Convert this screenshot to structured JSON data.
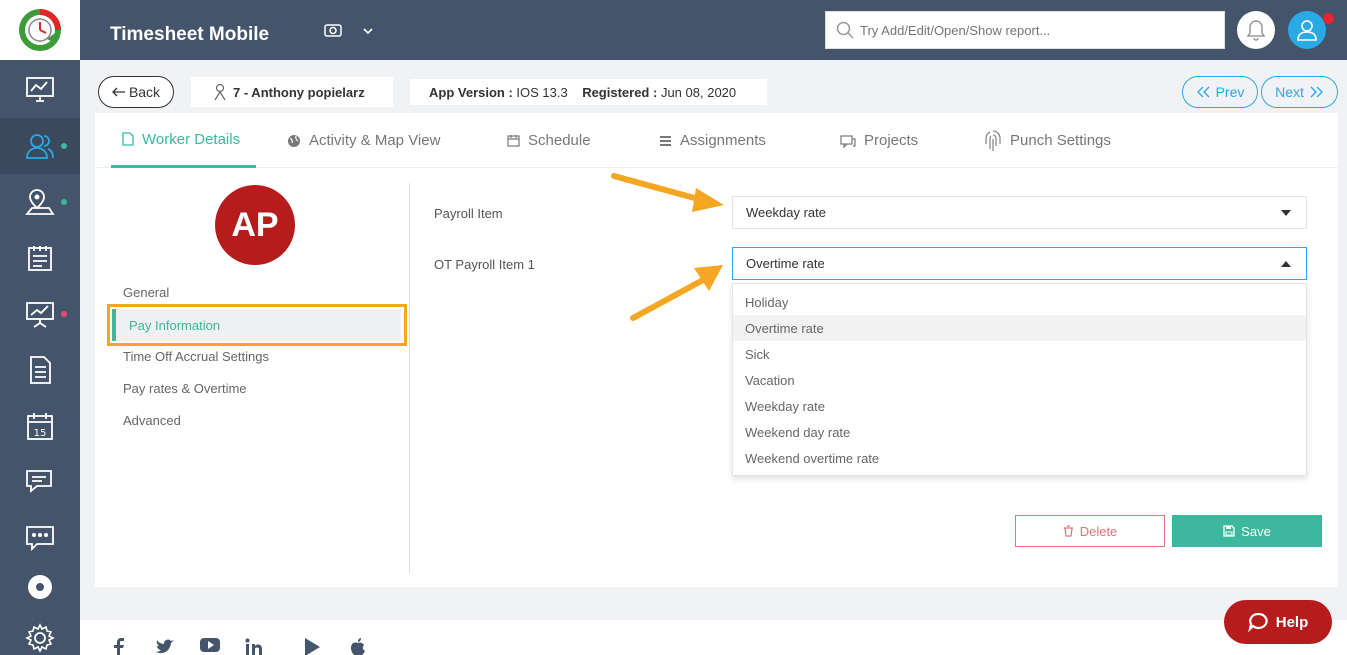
{
  "app": {
    "title": "Timesheet Mobile"
  },
  "search": {
    "placeholder": "Try Add/Edit/Open/Show report..."
  },
  "sidebar": {
    "items": [
      {
        "name": "dashboard",
        "icon": "monitor-chart-icon"
      },
      {
        "name": "workers",
        "icon": "users-icon",
        "active": true,
        "dot": "#3bb89d"
      },
      {
        "name": "locations",
        "icon": "map-pin-icon",
        "dot": "#3bb89d"
      },
      {
        "name": "timesheets",
        "icon": "clipboard-icon"
      },
      {
        "name": "reports",
        "icon": "presentation-chart-icon",
        "dot": "#e8496f"
      },
      {
        "name": "documents",
        "icon": "document-icon"
      },
      {
        "name": "calendar",
        "icon": "calendar-icon",
        "text": "15"
      },
      {
        "name": "messages",
        "icon": "chat-icon"
      },
      {
        "name": "sms",
        "icon": "message-dots-icon"
      },
      {
        "name": "record",
        "icon": "record-icon"
      },
      {
        "name": "settings",
        "icon": "gear-icon"
      }
    ]
  },
  "subheader": {
    "back_label": "Back",
    "worker_name": "7 - Anthony popielarz",
    "app_version_label": "App Version :",
    "app_version_value": "IOS 13.3",
    "registered_label": "Registered :",
    "registered_value": "Jun 08, 2020",
    "prev_label": "Prev",
    "next_label": "Next"
  },
  "tabs": [
    {
      "label": "Worker Details",
      "icon": "document-icon",
      "active": true
    },
    {
      "label": "Activity & Map View",
      "icon": "globe-icon"
    },
    {
      "label": "Schedule",
      "icon": "calendar-icon"
    },
    {
      "label": "Assignments",
      "icon": "list-icon"
    },
    {
      "label": "Projects",
      "icon": "projects-icon"
    },
    {
      "label": "Punch Settings",
      "icon": "fingerprint-icon"
    }
  ],
  "worker": {
    "initials": "AP"
  },
  "side_menu": {
    "general": "General",
    "pay_information": "Pay Information",
    "time_off": "Time Off Accrual Settings",
    "pay_rates": "Pay rates & Overtime",
    "advanced": "Advanced"
  },
  "form": {
    "payroll_item_label": "Payroll Item",
    "payroll_item_value": "Weekday rate",
    "ot_payroll_label": "OT Payroll Item 1",
    "ot_payroll_value": "Overtime rate",
    "options": [
      "Holiday",
      "Overtime rate",
      "Sick",
      "Vacation",
      "Weekday rate",
      "Weekend day rate",
      "Weekend overtime rate"
    ],
    "highlighted_option": "Overtime rate"
  },
  "actions": {
    "delete_label": "Delete",
    "save_label": "Save"
  },
  "help": {
    "label": "Help"
  },
  "footer": {
    "social": [
      "facebook-icon",
      "twitter-icon",
      "youtube-icon",
      "linkedin-icon",
      "google-play-icon",
      "apple-icon"
    ]
  },
  "colors": {
    "sidebar": "#44556b",
    "accent": "#3bb89d",
    "link": "#29a9e6",
    "danger": "#b71c1c",
    "annotation": "#f5a623"
  }
}
